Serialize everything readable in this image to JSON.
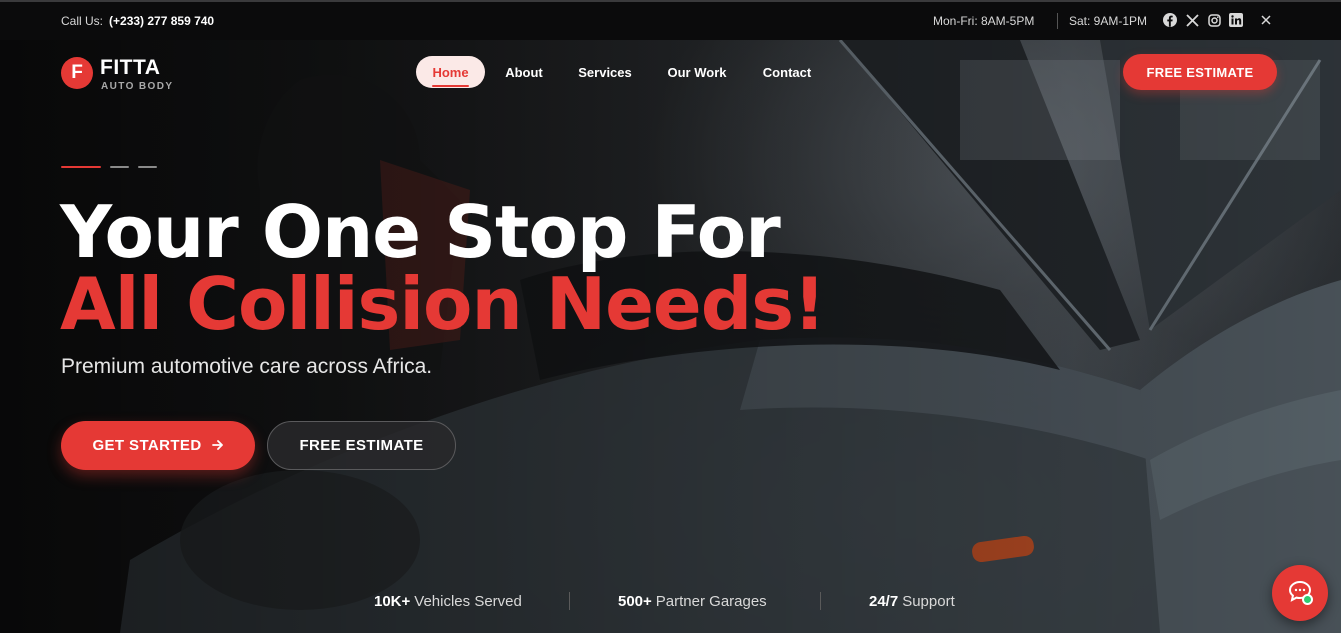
{
  "topbar": {
    "call_label": "Call Us:",
    "phone": "(+233) 277 859 740",
    "weekday_hours": "Mon-Fri: 8AM-5PM",
    "weekend_hours": "Sat: 9AM-1PM",
    "social_icons": [
      "facebook-icon",
      "x-icon",
      "instagram-icon",
      "linkedin-icon"
    ],
    "close_icon": "close-icon"
  },
  "brand": {
    "badge_letter": "F",
    "name": "FITTA",
    "subtitle": "AUTO BODY",
    "accent_color": "#e53935"
  },
  "nav": {
    "items": [
      {
        "label": "Home",
        "active": true
      },
      {
        "label": "About",
        "active": false
      },
      {
        "label": "Services",
        "active": false
      },
      {
        "label": "Our Work",
        "active": false
      },
      {
        "label": "Contact",
        "active": false
      }
    ],
    "cta": "FREE ESTIMATE"
  },
  "hero": {
    "slides": 3,
    "active_slide": 1,
    "headline_line1": "Your One Stop For",
    "headline_line2": "All Collision Needs!",
    "tagline": "Premium automotive care across Africa.",
    "primary_button": "GET STARTED",
    "primary_button_icon": "arrow-right-icon",
    "secondary_button": "FREE ESTIMATE"
  },
  "stats": [
    {
      "value": "10K+",
      "label": "Vehicles Served"
    },
    {
      "value": "500+",
      "label": "Partner Garages"
    },
    {
      "value": "24/7",
      "label": "Support"
    }
  ],
  "chat": {
    "icon": "chat-icon",
    "online_status_color": "#2ecc71"
  }
}
